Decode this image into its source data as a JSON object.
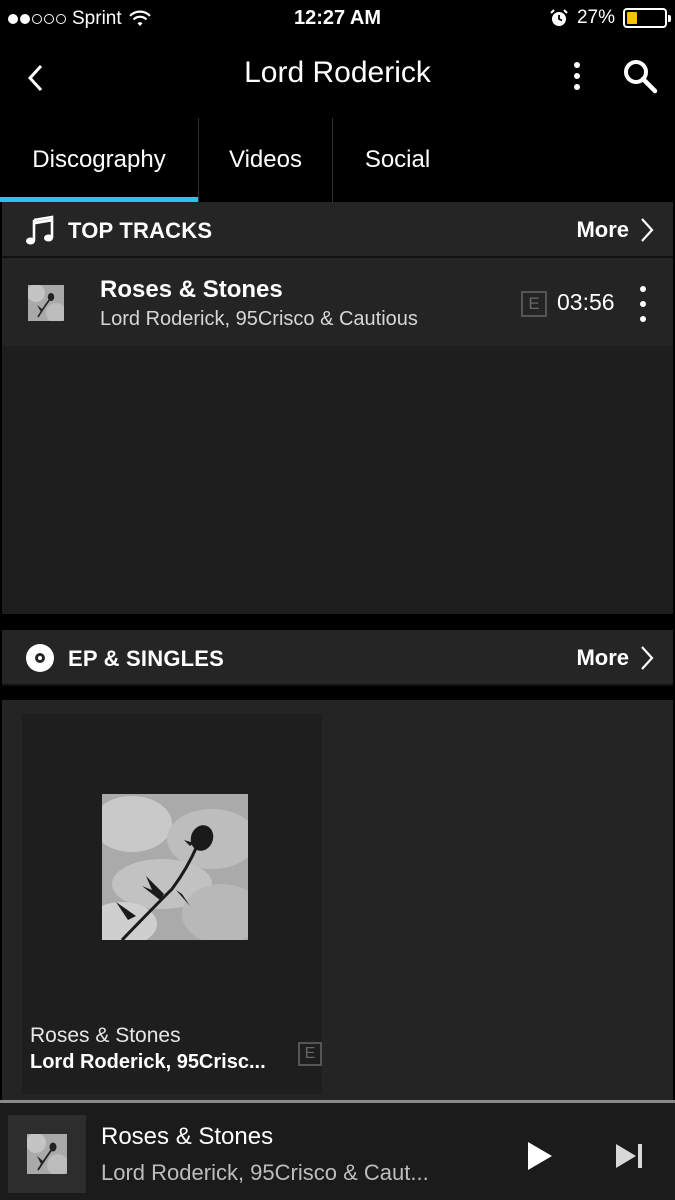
{
  "status_bar": {
    "carrier": "Sprint",
    "time": "12:27 AM",
    "battery_percent": "27%",
    "battery_level": 0.27,
    "signal_bars_filled": 2,
    "signal_bars_total": 5
  },
  "header": {
    "title": "Lord Roderick"
  },
  "tabs": [
    {
      "label": "Discography",
      "active": true
    },
    {
      "label": "Videos",
      "active": false
    },
    {
      "label": "Social",
      "active": false
    }
  ],
  "top_tracks": {
    "title": "TOP TRACKS",
    "more_label": "More",
    "tracks": [
      {
        "title": "Roses & Stones",
        "artists": "Lord Roderick, 95Crisco & Cautious",
        "explicit_label": "E",
        "duration": "03:56"
      }
    ]
  },
  "ep_singles": {
    "title": "EP & SINGLES",
    "more_label": "More",
    "items": [
      {
        "title": "Roses & Stones",
        "artists": "Lord Roderick, 95Crisc...",
        "explicit_label": "E"
      }
    ]
  },
  "now_playing": {
    "title": "Roses & Stones",
    "artists": "Lord Roderick, 95Crisco & Caut..."
  },
  "colors": {
    "accent": "#22c9e6",
    "battery": "#f5c400",
    "background": "#000000",
    "panel": "#242424"
  },
  "icons": [
    "back-chevron-icon",
    "more-vertical-icon",
    "search-icon",
    "music-note-icon",
    "disc-icon",
    "chevron-right-icon",
    "play-icon",
    "skip-next-icon",
    "wifi-icon",
    "alarm-icon",
    "battery-icon"
  ]
}
